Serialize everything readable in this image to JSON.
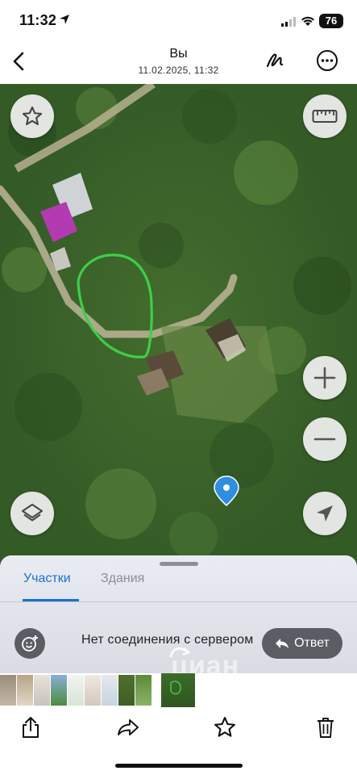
{
  "status_bar": {
    "time": "11:32",
    "battery": "76"
  },
  "header": {
    "title": "Вы",
    "subtitle": "11.02.2025, 11:32"
  },
  "map": {
    "icons": [
      "star-icon",
      "ruler-icon",
      "plus-icon",
      "minus-icon",
      "layers-icon",
      "location-arrow-icon",
      "map-pin-icon"
    ],
    "outline_color": "#3ecf4a",
    "pin_color": "#2f8ee0"
  },
  "sheet": {
    "tabs": [
      {
        "label": "Участки",
        "active": true
      },
      {
        "label": "Здания",
        "active": false
      }
    ],
    "message": "Нет соединения с сервером",
    "reply_label": "Ответ",
    "watermark": "циан",
    "accent": "#1b6fd6"
  },
  "thumbnails": {
    "count": 11
  },
  "toolbar": {
    "icons": [
      "share-icon",
      "forward-icon",
      "star-icon",
      "trash-icon"
    ]
  }
}
